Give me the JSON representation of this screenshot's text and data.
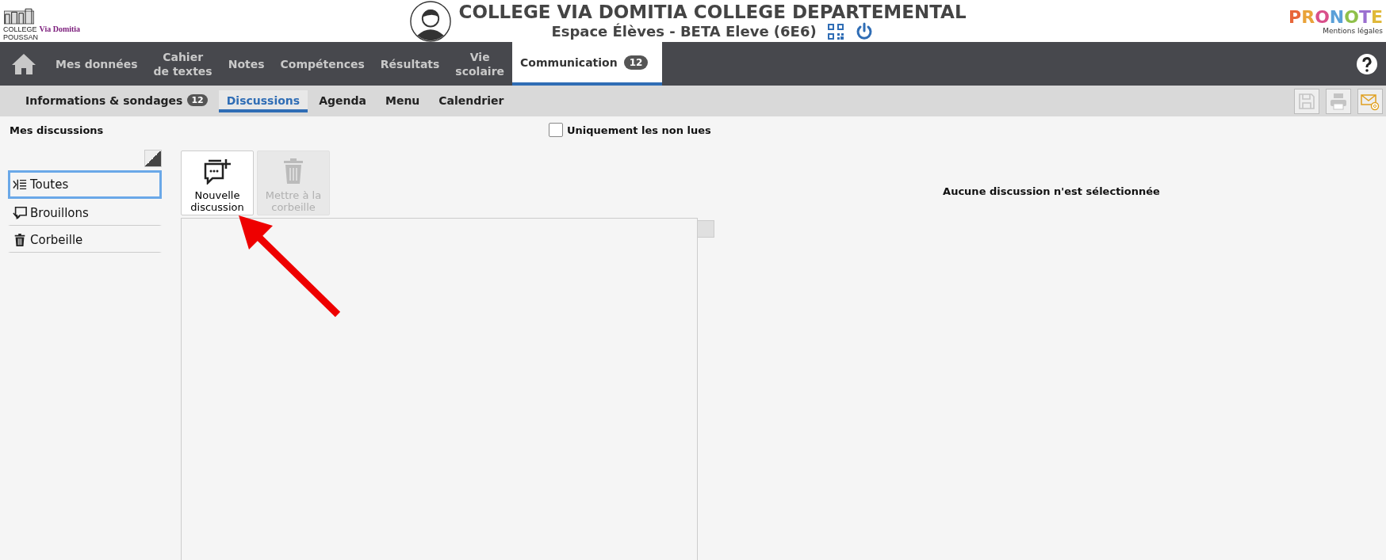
{
  "header": {
    "logo": {
      "line_1": "COLLEGE",
      "line_2": "POUSSAN",
      "script": "Via Domitia"
    },
    "school_name": "COLLEGE VIA DOMITIA COLLEGE DEPARTEMENTAL",
    "space_label": "Espace Élèves - BETA Eleve (6E6)",
    "brand": "PRONOTE",
    "legal_link": "Mentions légales"
  },
  "nav": {
    "tabs": [
      {
        "label": "Mes données",
        "selected": false
      },
      {
        "label": "Cahier\nde textes",
        "selected": false
      },
      {
        "label": "Notes",
        "selected": false
      },
      {
        "label": "Compétences",
        "selected": false
      },
      {
        "label": "Résultats",
        "selected": false
      },
      {
        "label": "Vie\nscolaire",
        "selected": false
      },
      {
        "label": "Communication",
        "selected": true,
        "badge": "12"
      }
    ]
  },
  "subnav": {
    "tabs": [
      {
        "label": "Informations & sondages",
        "selected": false,
        "badge": "12"
      },
      {
        "label": "Discussions",
        "selected": true
      },
      {
        "label": "Agenda",
        "selected": false
      },
      {
        "label": "Menu",
        "selected": false
      },
      {
        "label": "Calendrier",
        "selected": false
      }
    ]
  },
  "panel": {
    "title": "Mes discussions",
    "filter": {
      "label": "Uniquement les non lues",
      "checked": false
    }
  },
  "folders": [
    {
      "kind": "all",
      "label": "Toutes",
      "selected": true
    },
    {
      "kind": "drafts",
      "label": "Brouillons",
      "selected": false
    },
    {
      "kind": "trash",
      "label": "Corbeille",
      "selected": false
    }
  ],
  "actions": [
    {
      "kind": "new",
      "label": "Nouvelle\ndiscussion",
      "disabled": false
    },
    {
      "kind": "trash",
      "label": "Mettre à la\ncorbeille",
      "disabled": true
    }
  ],
  "detail": {
    "empty_message": "Aucune discussion n'est sélectionnée"
  }
}
